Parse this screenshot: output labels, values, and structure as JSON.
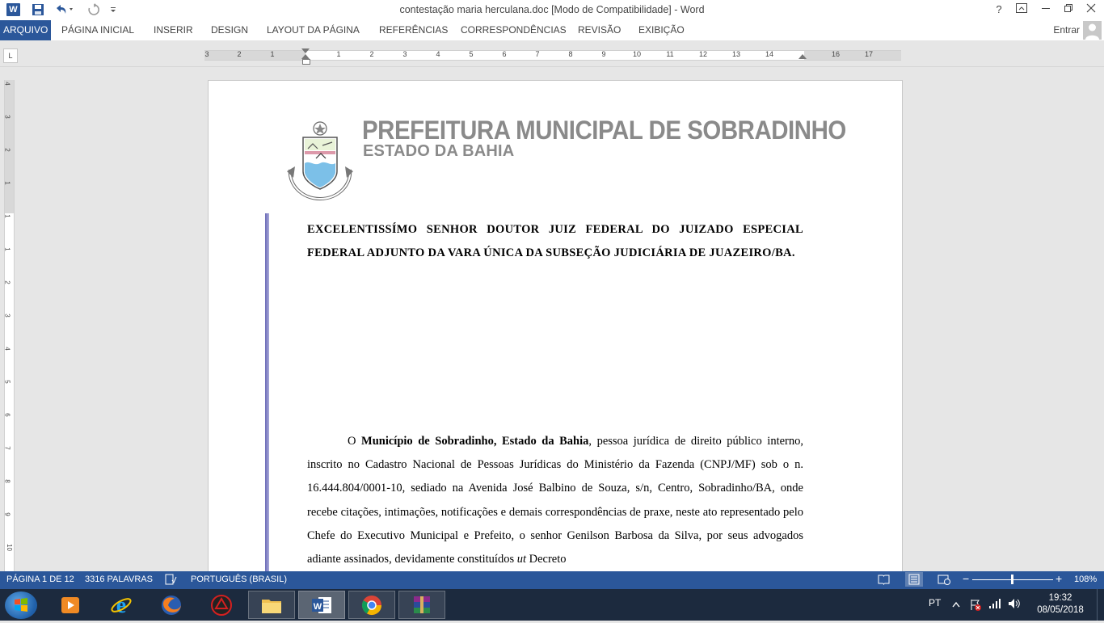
{
  "titlebar": {
    "app_icon": "W",
    "title": "contestação maria herculana.doc [Modo de Compatibilidade] - Word",
    "help": "?"
  },
  "tabs": [
    "ARQUIVO",
    "PÁGINA INICIAL",
    "INSERIR",
    "DESIGN",
    "LAYOUT DA PÁGINA",
    "REFERÊNCIAS",
    "CORRESPONDÊNCIAS",
    "REVISÃO",
    "EXIBIÇÃO"
  ],
  "signin": "Entrar",
  "ruler": {
    "tab_selector": "L",
    "numbers": [
      "3",
      "2",
      "1",
      "1",
      "2",
      "3",
      "4",
      "5",
      "6",
      "7",
      "8",
      "9",
      "10",
      "11",
      "12",
      "13",
      "14",
      "16",
      "17"
    ],
    "vertical_numbers": [
      "4",
      "3",
      "2",
      "1",
      "1",
      "1",
      "2",
      "3",
      "4",
      "5",
      "6",
      "7",
      "8",
      "9",
      "10"
    ]
  },
  "document": {
    "header_title": "PREFEITURA MUNICIPAL DE SOBRADINHO",
    "header_subtitle": "ESTADO DA BAHIA",
    "addressee": "EXCELENTISSÍMO SENHOR DOUTOR JUIZ FEDERAL DO JUIZADO ESPECIAL FEDERAL ADJUNTO DA VARA ÚNICA DA SUBSEÇÃO JUDICIÁRIA DE JUAZEIRO/BA.",
    "para_intro": "O ",
    "para_bold": "Município de Sobradinho, Estado da Bahia",
    "para_body": ", pessoa jurídica de direito público interno, inscrito no Cadastro Nacional de Pessoas Jurídicas do Ministério da Fazenda (CNPJ/MF) sob o n. 16.444.804/0001-10, sediado na Avenida José Balbino de Souza, s/n, Centro, Sobradinho/BA, onde recebe citações, intimações, notificações e demais correspondências de praxe, neste ato representado pelo Chefe do Executivo Municipal e Prefeito, o senhor Genilson Barbosa da Silva, por seus advogados adiante assinados, devidamente constituídos ",
    "para_italic": "ut",
    "para_tail": " Decreto"
  },
  "statusbar": {
    "page": "PÁGINA 1 DE 12",
    "words": "3316 PALAVRAS",
    "language": "PORTUGUÊS (BRASIL)",
    "zoom": "108%",
    "zoom_minus": "−",
    "zoom_plus": "+",
    "zoom_level": 108
  },
  "taskbar": {
    "apps": [
      "windows-media-player",
      "internet-explorer",
      "firefox",
      "app-red-icon",
      "file-explorer",
      "word",
      "chrome",
      "winrar"
    ],
    "language": "PT",
    "time": "19:32",
    "date": "08/05/2018"
  },
  "colors": {
    "accent": "#2b579a",
    "taskbar": "#1c2a3e",
    "header_gray": "#8a8a8a"
  }
}
